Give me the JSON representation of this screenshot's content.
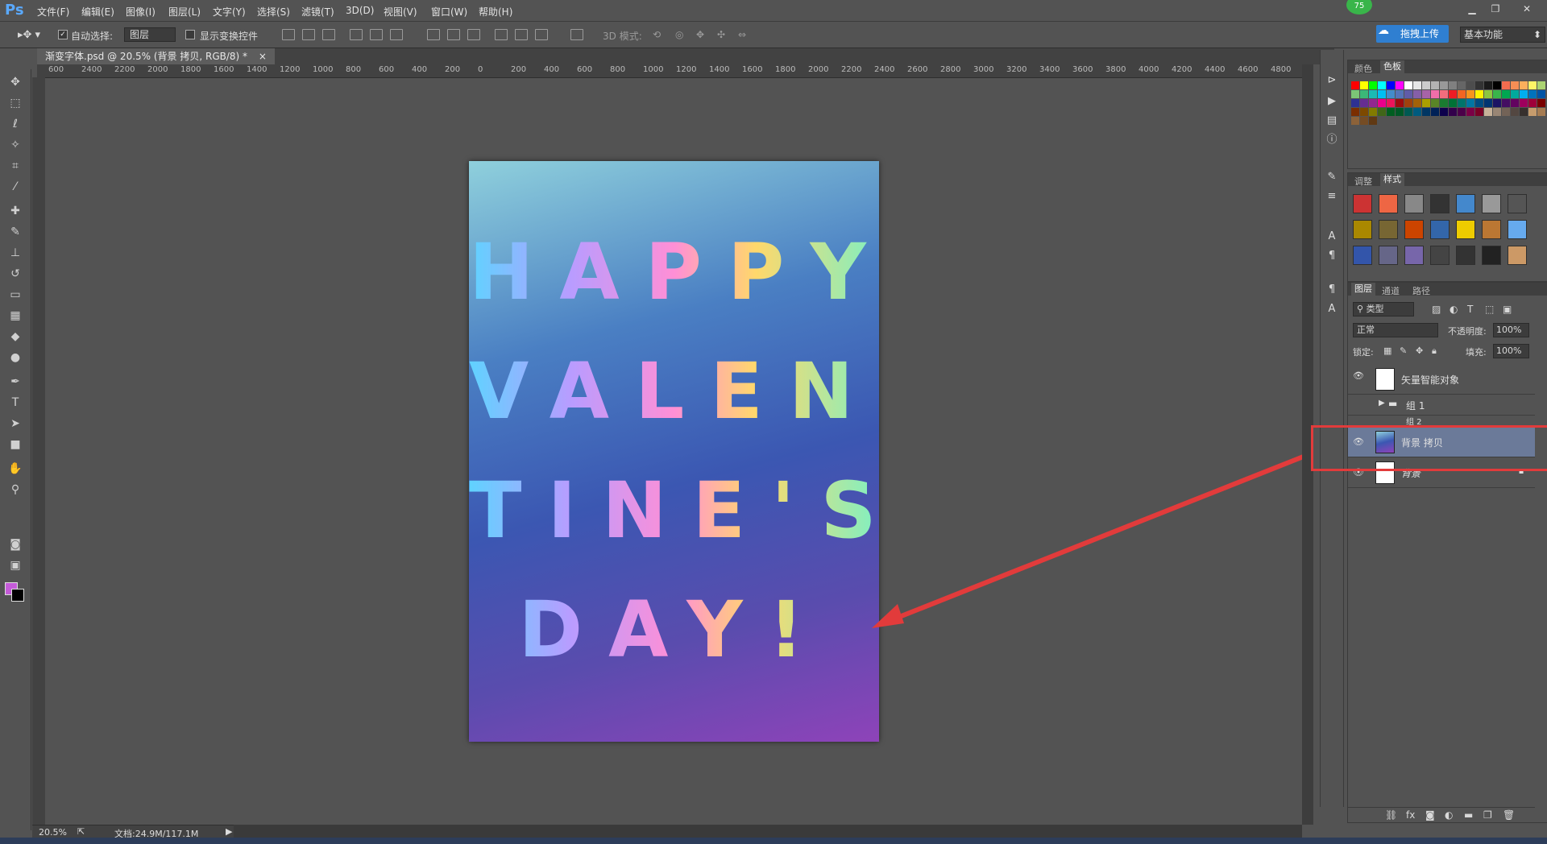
{
  "app": {
    "logo": "Ps",
    "badge": "75"
  },
  "menu": [
    "文件(F)",
    "编辑(E)",
    "图像(I)",
    "图层(L)",
    "文字(Y)",
    "选择(S)",
    "滤镜(T)",
    "3D(D)",
    "视图(V)",
    "窗口(W)",
    "帮助(H)"
  ],
  "options": {
    "auto_select_label": "自动选择:",
    "auto_select_value": "图层",
    "show_transform_label": "显示变换控件",
    "mode_3d_label": "3D 模式:",
    "upload_label": "拖拽上传",
    "workspace": "基本功能"
  },
  "document": {
    "tab_title": "渐变字体.psd @ 20.5% (背景 拷贝, RGB/8) *",
    "close": "×"
  },
  "ruler_ticks": [
    "600",
    "2400",
    "2200",
    "2000",
    "1800",
    "1600",
    "1400",
    "1200",
    "1000",
    "800",
    "600",
    "400",
    "200",
    "0",
    "200",
    "400",
    "600",
    "800",
    "1000",
    "1200",
    "1400",
    "1600",
    "1800",
    "2000",
    "2200",
    "2400",
    "2600",
    "2800",
    "3000",
    "3200",
    "3400",
    "3600",
    "3800",
    "4000",
    "4200",
    "4400",
    "4600",
    "4800"
  ],
  "artwork": {
    "lines": [
      "HAPPY",
      "VALEN",
      "TINE'S",
      "DAY!"
    ]
  },
  "status": {
    "zoom": "20.5%",
    "doc": "文档:24.9M/117.1M"
  },
  "panels": {
    "color_tabs": [
      "颜色",
      "色板"
    ],
    "adjust_tabs": [
      "调整",
      "样式"
    ],
    "layer_tabs": [
      "图层",
      "通道",
      "路径"
    ],
    "filter_kind": "类型",
    "blend_mode": "正常",
    "opacity_label": "不透明度:",
    "opacity_value": "100%",
    "lock_label": "锁定:",
    "fill_label": "填充:",
    "fill_value": "100%"
  },
  "layers": [
    {
      "name": "矢量智能对象",
      "visible": true
    },
    {
      "name": "组 1",
      "visible": false
    },
    {
      "name": "组 2",
      "visible": false
    },
    {
      "name": "背景 拷贝",
      "visible": true,
      "selected": true
    },
    {
      "name": "背景",
      "visible": true,
      "locked": true
    }
  ],
  "colors": {
    "selection_highlight": "#e23b3b",
    "arrow": "#e23b3b",
    "foreground": "#c45bd8",
    "background": "#000000"
  }
}
